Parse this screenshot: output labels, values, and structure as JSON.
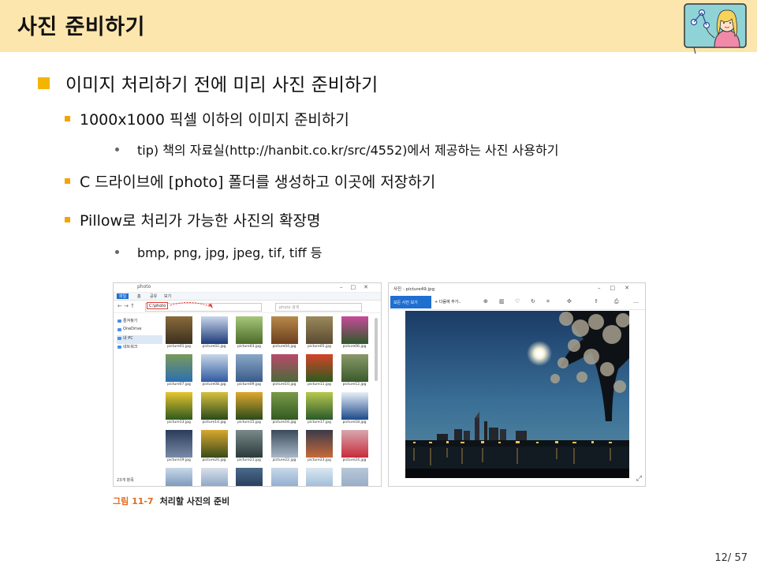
{
  "header": {
    "title": "사진 준비하기"
  },
  "bullets": {
    "l1": "이미지 처리하기 전에 미리 사진 준비하기",
    "l2a": "1000x1000 픽셀 이하의 이미지 준비하기",
    "l3a": "tip) 책의 자료실(http://hanbit.co.kr/src/4552)에서  제공하는 사진 사용하기",
    "l2b": "C 드라이브에 [photo] 폴더를 생성하고 이곳에 저장하기",
    "l2c": "Pillow로 처리가 가능한 사진의 확장명",
    "l3b": "bmp, png, jpg, jpeg, tif, tiff 등"
  },
  "explorer": {
    "window_title": "photo",
    "ribbon": [
      "파일",
      "홈",
      "공유",
      "보기"
    ],
    "path": "C:\\photo",
    "search_placeholder": "photo 검색",
    "sidebar": [
      "즐겨찾기",
      "OneDrive",
      "내 PC",
      "네트워크"
    ],
    "status": "23개 항목",
    "thumbnails": [
      {
        "name": "picture01.jpg",
        "c1": "#3a2f1f",
        "c2": "#8a6b3a"
      },
      {
        "name": "picture02.jpg",
        "c1": "#1d3a78",
        "c2": "#c9d7ea"
      },
      {
        "name": "picture03.jpg",
        "c1": "#4a6b2a",
        "c2": "#a8c77a"
      },
      {
        "name": "picture04.jpg",
        "c1": "#6b3f1e",
        "c2": "#b88a4a"
      },
      {
        "name": "picture05.jpg",
        "c1": "#5a4a32",
        "c2": "#9a8a5a"
      },
      {
        "name": "picture06.jpg",
        "c1": "#2e5a2a",
        "c2": "#c84a9a"
      },
      {
        "name": "picture07.jpg",
        "c1": "#2b6fb0",
        "c2": "#7a9a5a"
      },
      {
        "name": "picture08.jpg",
        "c1": "#2f5aa0",
        "c2": "#c8d6e8"
      },
      {
        "name": "picture09.jpg",
        "c1": "#3a5a8a",
        "c2": "#8aa8c8"
      },
      {
        "name": "picture10.jpg",
        "c1": "#4a6a3a",
        "c2": "#b84a6a"
      },
      {
        "name": "picture11.jpg",
        "c1": "#2e5a1e",
        "c2": "#d4442a"
      },
      {
        "name": "picture12.jpg",
        "c1": "#3a5a2a",
        "c2": "#8a9a6a"
      },
      {
        "name": "picture13.jpg",
        "c1": "#2e5a1e",
        "c2": "#e8c430"
      },
      {
        "name": "picture14.jpg",
        "c1": "#2a4a1a",
        "c2": "#d8c040"
      },
      {
        "name": "picture15.jpg",
        "c1": "#2a4a1a",
        "c2": "#e0a830"
      },
      {
        "name": "picture16.jpg",
        "c1": "#335a22",
        "c2": "#7a9a4a"
      },
      {
        "name": "picture17.jpg",
        "c1": "#2a5a2a",
        "c2": "#b8c850"
      },
      {
        "name": "picture18.jpg",
        "c1": "#1d4a8a",
        "c2": "#e8f0f8"
      },
      {
        "name": "picture19.jpg",
        "c1": "#7a8aa8",
        "c2": "#2a3a5a"
      },
      {
        "name": "picture20.jpg",
        "c1": "#3a4a1a",
        "c2": "#d8a830"
      },
      {
        "name": "picture21.jpg",
        "c1": "#2a3a3a",
        "c2": "#7a8a8a"
      },
      {
        "name": "picture22.jpg",
        "c1": "#a8b8c8",
        "c2": "#3a4a5a"
      },
      {
        "name": "picture23.jpg",
        "c1": "#c86a3a",
        "c2": "#3a3a4a"
      },
      {
        "name": "picture24.jpg",
        "c1": "#c82a3a",
        "c2": "#d8a8b0"
      },
      {
        "name": "",
        "c1": "#5a7aa8",
        "c2": "#c8d8e8"
      },
      {
        "name": "",
        "c1": "#6a8ab8",
        "c2": "#d8e0e8"
      },
      {
        "name": "",
        "c1": "#1a2a4a",
        "c2": "#4a6a8a"
      },
      {
        "name": "",
        "c1": "#7a9ac8",
        "c2": "#c8d8e8"
      },
      {
        "name": "",
        "c1": "#8aa8d0",
        "c2": "#d8e8f0"
      },
      {
        "name": "",
        "c1": "#8aa0c0",
        "c2": "#b8c8d8"
      }
    ]
  },
  "viewer": {
    "window_title": "사진 - picture49.jpg",
    "all_photos_label": "모든 사진 보기",
    "add_label": "+ 다음에 추가.."
  },
  "caption": {
    "number": "그림 11-7",
    "text": "처리할 사진의 준비"
  },
  "page": {
    "number": "12/ 57"
  },
  "colors": {
    "header_bg": "#fde6ad",
    "bullet_l1": "#f4b400",
    "bullet_l2": "#f4a300",
    "caption_num": "#e26b1e"
  }
}
